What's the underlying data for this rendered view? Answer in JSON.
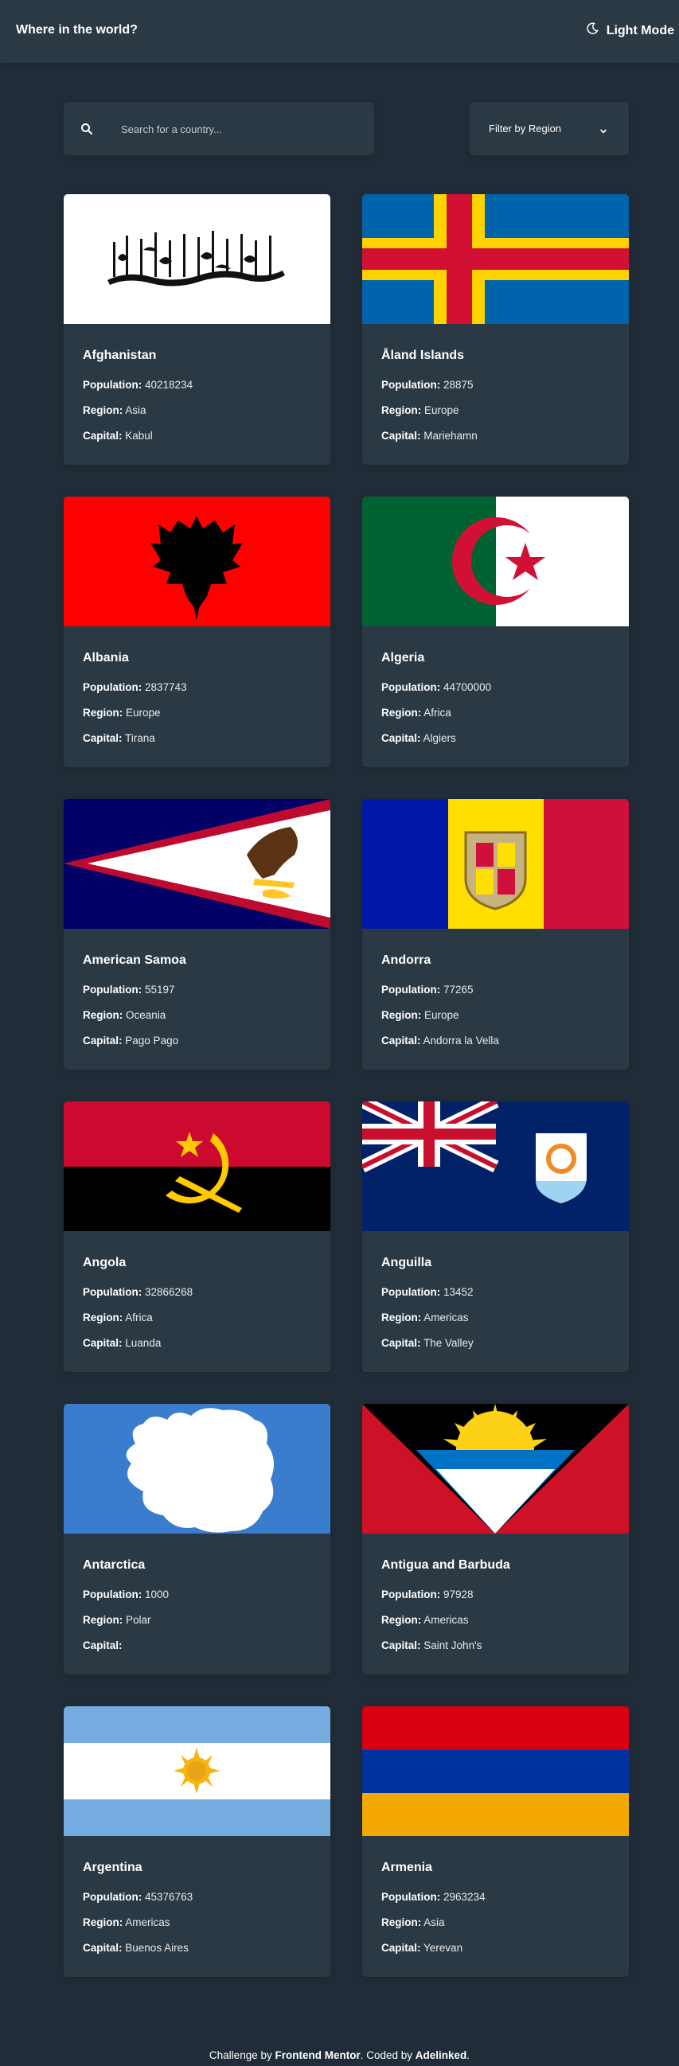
{
  "header": {
    "title": "Where in the world?",
    "mode_label": "Light Mode",
    "mode_icon": "moon-icon"
  },
  "controls": {
    "search_placeholder": "Search for a country...",
    "search_icon": "search-icon",
    "filter_label": "Filter by Region",
    "filter_icon": "chevron-down-icon"
  },
  "labels": {
    "population": "Population:",
    "region": "Region:",
    "capital": "Capital:"
  },
  "countries": [
    {
      "name": "Afghanistan",
      "population": "40218234",
      "region": "Asia",
      "capital": "Kabul"
    },
    {
      "name": "Åland Islands",
      "population": "28875",
      "region": "Europe",
      "capital": "Mariehamn"
    },
    {
      "name": "Albania",
      "population": "2837743",
      "region": "Europe",
      "capital": "Tirana"
    },
    {
      "name": "Algeria",
      "population": "44700000",
      "region": "Africa",
      "capital": "Algiers"
    },
    {
      "name": "American Samoa",
      "population": "55197",
      "region": "Oceania",
      "capital": "Pago Pago"
    },
    {
      "name": "Andorra",
      "population": "77265",
      "region": "Europe",
      "capital": "Andorra la Vella"
    },
    {
      "name": "Angola",
      "population": "32866268",
      "region": "Africa",
      "capital": "Luanda"
    },
    {
      "name": "Anguilla",
      "population": "13452",
      "region": "Americas",
      "capital": "The Valley"
    },
    {
      "name": "Antarctica",
      "population": "1000",
      "region": "Polar",
      "capital": ""
    },
    {
      "name": "Antigua and Barbuda",
      "population": "97928",
      "region": "Americas",
      "capital": "Saint John's"
    },
    {
      "name": "Argentina",
      "population": "45376763",
      "region": "Americas",
      "capital": "Buenos Aires"
    },
    {
      "name": "Armenia",
      "population": "2963234",
      "region": "Asia",
      "capital": "Yerevan"
    }
  ],
  "footer": {
    "prefix": "Challenge by ",
    "link1": "Frontend Mentor",
    "middle": ". Coded by ",
    "link2": "Adelinked",
    "suffix": "."
  },
  "colors": {
    "background": "#202c37",
    "surface": "#2b3945",
    "text": "#ffffff"
  }
}
